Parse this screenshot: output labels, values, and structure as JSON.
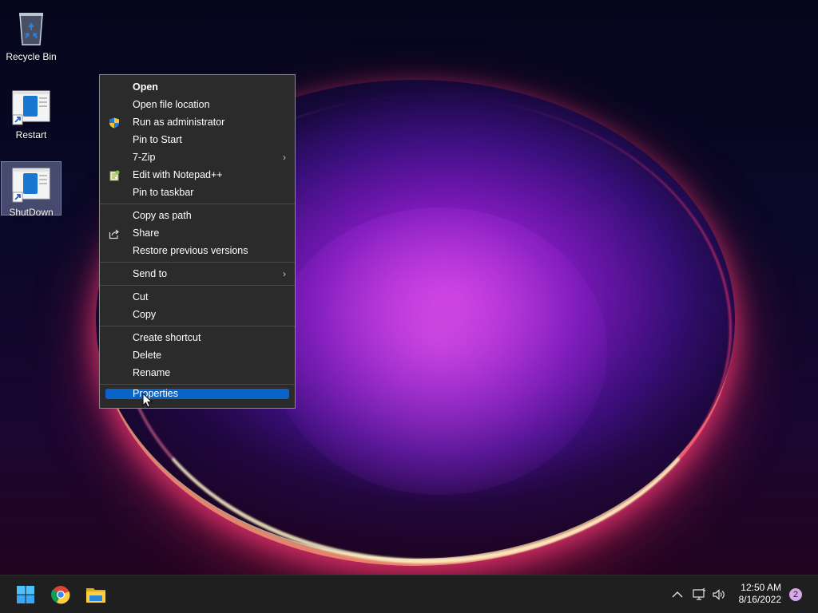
{
  "desktop": {
    "icons": [
      {
        "label": "Recycle Bin",
        "icon": "recycle-bin-icon"
      },
      {
        "label": "Restart",
        "icon": "shortcut-icon"
      },
      {
        "label": "ShutDown",
        "icon": "shortcut-icon",
        "selected": true
      }
    ]
  },
  "context_menu": {
    "items": [
      {
        "label": "Open",
        "bold": true
      },
      {
        "label": "Open file location"
      },
      {
        "label": "Run as administrator",
        "icon": "uac-shield-icon"
      },
      {
        "label": "Pin to Start"
      },
      {
        "label": "7-Zip",
        "submenu": true
      },
      {
        "label": "Edit with Notepad++",
        "icon": "notepad-plus-plus-icon"
      },
      {
        "label": "Pin to taskbar"
      },
      {
        "label": "Copy as path"
      },
      {
        "label": "Share",
        "icon": "share-icon"
      },
      {
        "label": "Restore previous versions"
      },
      {
        "label": "Send to",
        "submenu": true
      },
      {
        "label": "Cut"
      },
      {
        "label": "Copy"
      },
      {
        "label": "Create shortcut"
      },
      {
        "label": "Delete"
      },
      {
        "label": "Rename"
      },
      {
        "label": "Properties",
        "highlighted": true
      }
    ],
    "submenu_arrow": "›"
  },
  "taskbar": {
    "apps": [
      "windows-start-icon",
      "chrome-icon",
      "file-explorer-icon"
    ],
    "clock_time": "12:50 AM",
    "clock_date": "8/16/2022",
    "notification_count": "2"
  },
  "colors": {
    "menu_bg": "#2b2b2b",
    "highlight": "#0a64c8",
    "taskbar_bg": "#1f1f1f"
  }
}
